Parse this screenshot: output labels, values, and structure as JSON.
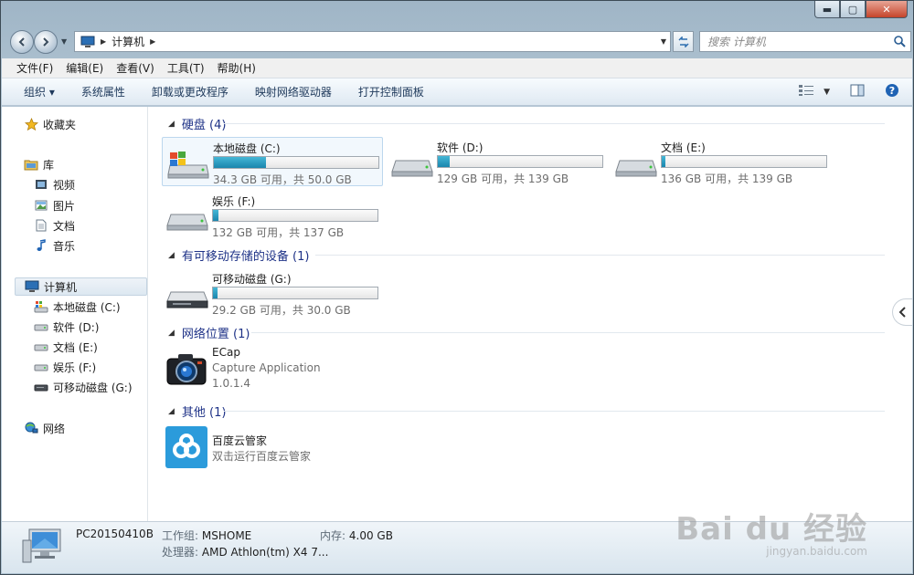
{
  "window": {
    "caption": {
      "minimize": "▬",
      "maximize": "▢",
      "close": "✕"
    }
  },
  "address": {
    "path": [
      "计算机"
    ]
  },
  "search": {
    "placeholder": "搜索 计算机"
  },
  "menu": [
    "文件(F)",
    "编辑(E)",
    "查看(V)",
    "工具(T)",
    "帮助(H)"
  ],
  "commands": [
    "组织 ▾",
    "系统属性",
    "卸载或更改程序",
    "映射网络驱动器",
    "打开控制面板"
  ],
  "sidebar": {
    "favorites": "收藏夹",
    "libraries": "库",
    "library_items": [
      "视频",
      "图片",
      "文档",
      "音乐"
    ],
    "computer": "计算机",
    "drives": [
      "本地磁盘 (C:)",
      "软件 (D:)",
      "文档 (E:)",
      "娱乐 (F:)",
      "可移动磁盘 (G:)"
    ],
    "network": "网络"
  },
  "groups": {
    "hard_disks": "硬盘 (4)",
    "removable": "有可移动存储的设备 (1)",
    "network_locations": "网络位置 (1)",
    "other": "其他 (1)"
  },
  "drives": [
    {
      "name": "本地磁盘 (C:)",
      "free": "34.3 GB 可用，共 50.0 GB",
      "used_fraction": 0.314
    },
    {
      "name": "软件 (D:)",
      "free": "129 GB 可用，共 139 GB",
      "used_fraction": 0.072
    },
    {
      "name": "文档 (E:)",
      "free": "136 GB 可用，共 139 GB",
      "used_fraction": 0.022
    },
    {
      "name": "娱乐 (F:)",
      "free": "132 GB 可用，共 137 GB",
      "used_fraction": 0.036
    },
    {
      "name": "可移动磁盘 (G:)",
      "free": "29.2 GB 可用，共 30.0 GB",
      "used_fraction": 0.027
    }
  ],
  "network_app": {
    "name": "ECap",
    "desc": "Capture Application",
    "version": "1.0.1.4"
  },
  "other_app": {
    "name": "百度云管家",
    "desc": "双击运行百度云管家"
  },
  "details": {
    "pc_name": "PC20150410B",
    "workgroup_label": "工作组:",
    "workgroup": "MSHOME",
    "memory_label": "内存:",
    "memory": "4.00 GB",
    "cpu_label": "处理器:",
    "cpu": "AMD Athlon(tm) X4 7..."
  },
  "watermark": {
    "line1": "Bai du 经验",
    "line2": "jingyan.baidu.com"
  },
  "colors": {
    "accent": "#1e3287",
    "bar_fill": "#1a86ad"
  }
}
